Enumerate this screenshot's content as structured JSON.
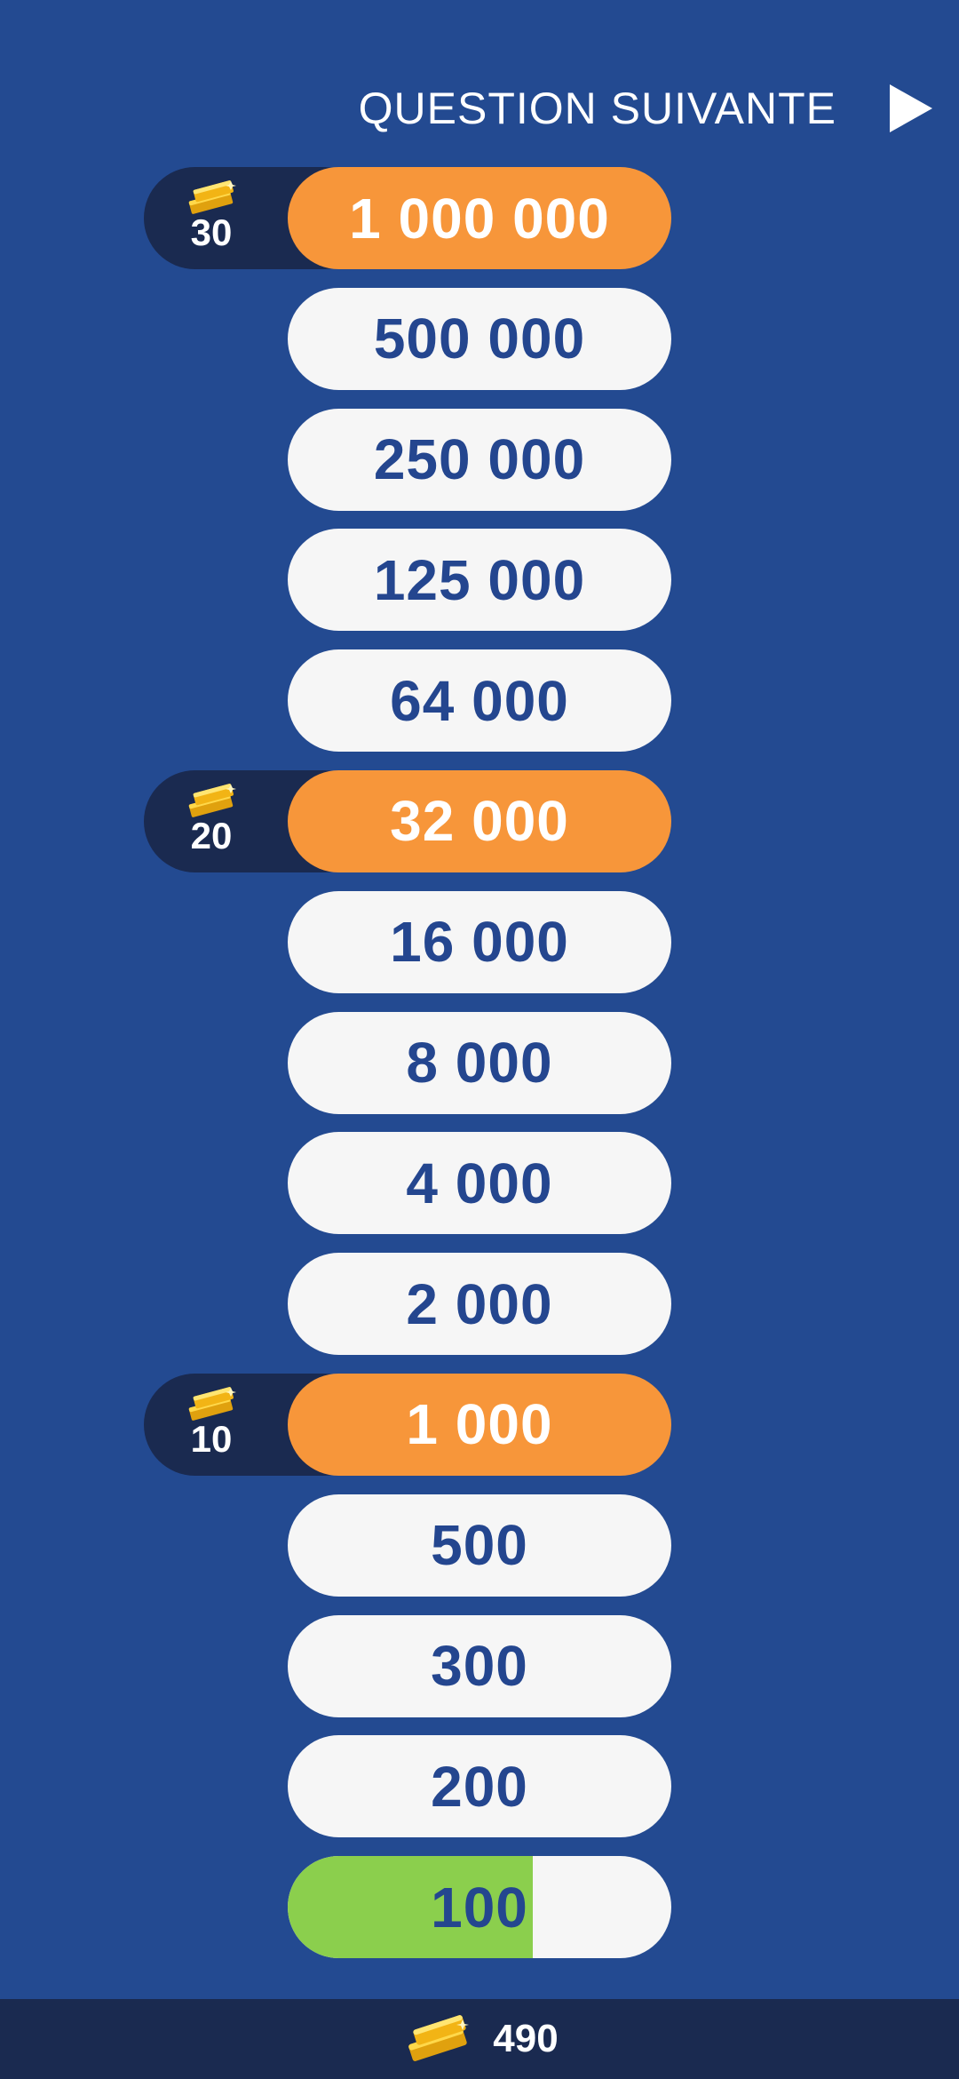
{
  "header": {
    "next_label": "QUESTION SUIVANTE"
  },
  "icons": {
    "next": "play-arrow-icon",
    "currency": "gold-bars-icon"
  },
  "colors": {
    "background": "#234a91",
    "pill": "#f6f6f6",
    "milestone": "#f7963a",
    "current_fill": "#8bcf4d",
    "badge": "#1a2a50",
    "amount_text": "#24468f"
  },
  "ladder": [
    {
      "amount": "1 000 000",
      "milestone": true,
      "reward": "30"
    },
    {
      "amount": "500 000"
    },
    {
      "amount": "250 000"
    },
    {
      "amount": "125 000"
    },
    {
      "amount": "64 000"
    },
    {
      "amount": "32 000",
      "milestone": true,
      "reward": "20"
    },
    {
      "amount": "16 000"
    },
    {
      "amount": "8 000"
    },
    {
      "amount": "4 000"
    },
    {
      "amount": "2 000"
    },
    {
      "amount": "1 000",
      "milestone": true,
      "reward": "10"
    },
    {
      "amount": "500"
    },
    {
      "amount": "300"
    },
    {
      "amount": "200"
    },
    {
      "amount": "100",
      "current": true,
      "progress": 0.64
    }
  ],
  "footer": {
    "balance": "490"
  }
}
